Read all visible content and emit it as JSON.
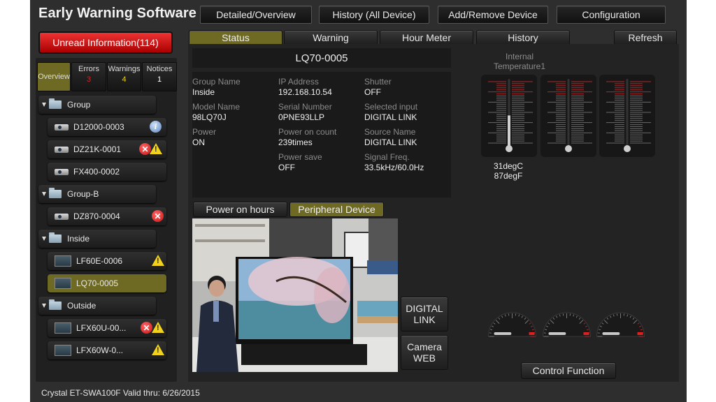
{
  "app": {
    "title": "Early Warning Software",
    "footer": "Crystal  ET-SWA100F  Valid thru: 6/26/2015"
  },
  "top_nav": [
    {
      "label": "Detailed/Overview"
    },
    {
      "label": "History (All Device)"
    },
    {
      "label": "Add/Remove Device"
    },
    {
      "label": "Configuration"
    }
  ],
  "unread": {
    "label": "Unread Information(114)",
    "color": "#d01c1c"
  },
  "filters": [
    {
      "label": "Overview",
      "count": null,
      "active": true
    },
    {
      "label": "Errors",
      "count": "3",
      "count_color": "#e02020"
    },
    {
      "label": "Warnings",
      "count": "4",
      "count_color": "#e8d020"
    },
    {
      "label": "Notices",
      "count": "1",
      "count_color": "#ffffff"
    }
  ],
  "tree": {
    "groups": [
      {
        "name": "Group",
        "devices": [
          {
            "name": "D12000-0003",
            "type": "projector",
            "icons": [
              "info"
            ]
          },
          {
            "name": "DZ21K-0001",
            "type": "projector",
            "icons": [
              "error",
              "warning"
            ]
          },
          {
            "name": "FX400-0002",
            "type": "projector",
            "icons": []
          }
        ]
      },
      {
        "name": "Group-B",
        "devices": [
          {
            "name": "DZ870-0004",
            "type": "projector",
            "icons": [
              "error"
            ]
          }
        ]
      },
      {
        "name": "Inside",
        "devices": [
          {
            "name": "LF60E-0006",
            "type": "display",
            "icons": [
              "warning"
            ]
          },
          {
            "name": "LQ70-0005",
            "type": "display",
            "icons": [],
            "selected": true
          }
        ]
      },
      {
        "name": "Outside",
        "devices": [
          {
            "name": "LFX60U-00...",
            "type": "display",
            "icons": [
              "error",
              "warning"
            ]
          },
          {
            "name": "LFX60W-0...",
            "type": "display",
            "icons": [
              "warning"
            ]
          }
        ]
      }
    ]
  },
  "tabs": [
    {
      "label": "Status",
      "active": true
    },
    {
      "label": "Warning"
    },
    {
      "label": "Hour Meter"
    },
    {
      "label": "History"
    }
  ],
  "refresh_label": "Refresh",
  "device": {
    "name": "LQ70-0005",
    "fields": [
      {
        "key": "Group Name",
        "value": "Inside"
      },
      {
        "key": "Model Name",
        "value": "98LQ70J"
      },
      {
        "key": "Power",
        "value": "ON"
      },
      {
        "key": "IP Address",
        "value": "192.168.10.54"
      },
      {
        "key": "Serial Number",
        "value": "0PNE93LLP"
      },
      {
        "key": "Power on count",
        "value": "239times"
      },
      {
        "key": "Power save",
        "value": "OFF"
      },
      {
        "key": "Shutter",
        "value": "OFF"
      },
      {
        "key": "Selected input",
        "value": "DIGITAL LINK"
      },
      {
        "key": "Source Name",
        "value": "DIGITAL LINK"
      },
      {
        "key": "Signal Freq.",
        "value": "33.5kHz/60.0Hz"
      }
    ]
  },
  "subtabs": [
    {
      "label": "Power on hours"
    },
    {
      "label": "Peripheral Device",
      "active": true
    }
  ],
  "peripheral_buttons": [
    {
      "label_line1": "DIGITAL",
      "label_line2": "LINK"
    },
    {
      "label_line1": "Camera",
      "label_line2": "WEB"
    }
  ],
  "temperature": {
    "label_line1": "Internal",
    "label_line2": "Temperature1",
    "celsius": "31degC",
    "fahrenheit": "87degF",
    "levels": [
      0.45,
      0.0,
      0.0
    ]
  },
  "gauges": {
    "levels": [
      0.4,
      0.4,
      0.4
    ]
  },
  "control_function_label": "Control Function",
  "colors": {
    "accent_olive": "#6e6a24",
    "error_red": "#d01c1c",
    "warning_yellow": "#f2d21a"
  }
}
